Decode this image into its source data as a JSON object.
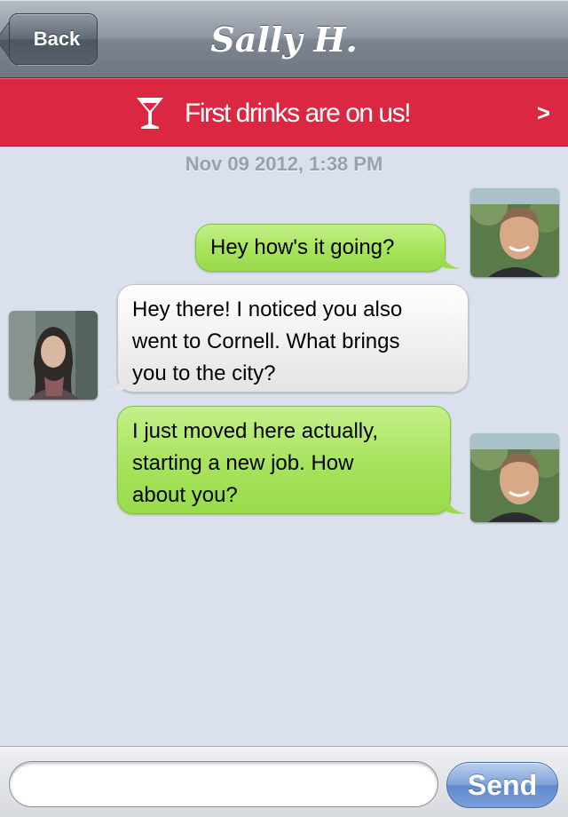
{
  "nav": {
    "back_label": "Back",
    "title": "Sally H."
  },
  "promo": {
    "icon": "cocktail-glass-icon",
    "text": "First drinks are on us!",
    "arrow": ">"
  },
  "chat": {
    "timestamp": "Nov 09 2012, 1:38 PM",
    "messages": [
      {
        "sender": "me",
        "text": "Hey how's it going?"
      },
      {
        "sender": "sally",
        "lines": [
          "Hey there! I noticed you also",
          "went to Cornell. What brings",
          "you to the city?"
        ]
      },
      {
        "sender": "me",
        "lines": [
          "I just moved here actually,",
          "starting a new job. How",
          "about you?"
        ]
      }
    ]
  },
  "composer": {
    "value": "",
    "placeholder": "",
    "send_label": "Send"
  },
  "colors": {
    "promo_red": "#db2742",
    "outgoing_bubble": "#a7e35c",
    "incoming_bubble": "#f0f0f0",
    "chat_background": "#dbe1ec",
    "send_blue": "#6289cf"
  }
}
